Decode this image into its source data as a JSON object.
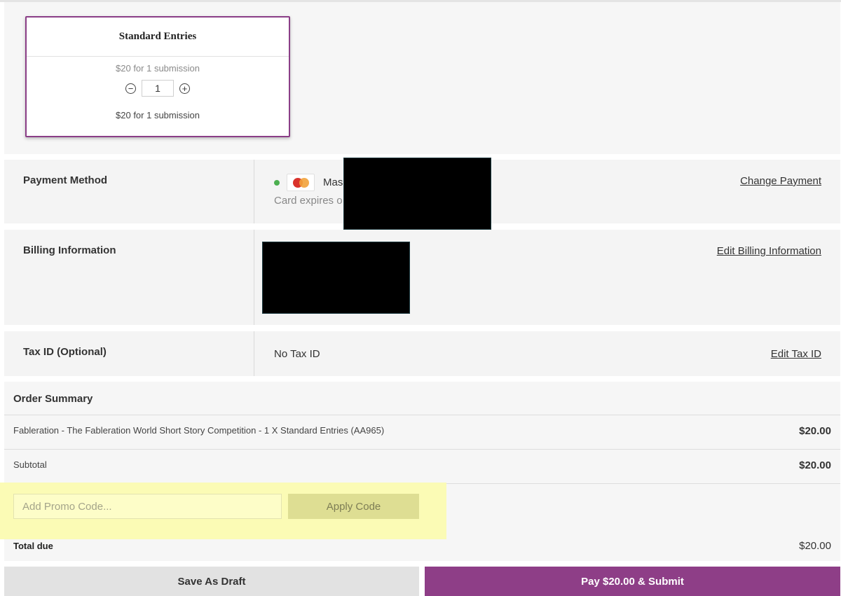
{
  "entry_tier": {
    "title": "Standard Entries",
    "price_text": "$20 for 1 submission",
    "quantity": "1",
    "decrement_symbol": "−",
    "increment_symbol": "+",
    "total_text": "$20 for 1 submission"
  },
  "payment_method": {
    "label": "Payment Method",
    "card_brand_partial": "Mas",
    "expiry_partial": "Card expires o",
    "change_link": "Change Payment",
    "card_icon": "mastercard-icon"
  },
  "billing": {
    "label": "Billing Information",
    "edit_link": "Edit Billing Information"
  },
  "tax": {
    "label": "Tax ID (Optional)",
    "value": "No Tax ID",
    "edit_link": "Edit Tax ID"
  },
  "order_summary": {
    "title": "Order Summary",
    "line_item": {
      "description": "Fableration - The Fableration World Short Story Competition - 1 X Standard Entries (AA965)",
      "amount": "$20.00"
    },
    "subtotal": {
      "label": "Subtotal",
      "amount": "$20.00"
    },
    "promo": {
      "placeholder": "Add Promo Code...",
      "apply_label": "Apply Code"
    },
    "total": {
      "label": "Total due",
      "amount": "$20.00"
    }
  },
  "actions": {
    "draft_label": "Save As Draft",
    "pay_label": "Pay $20.00 & Submit"
  },
  "colors": {
    "accent": "#8e3e87",
    "highlight": "#fbfbb5",
    "status_green": "#4caf50"
  }
}
